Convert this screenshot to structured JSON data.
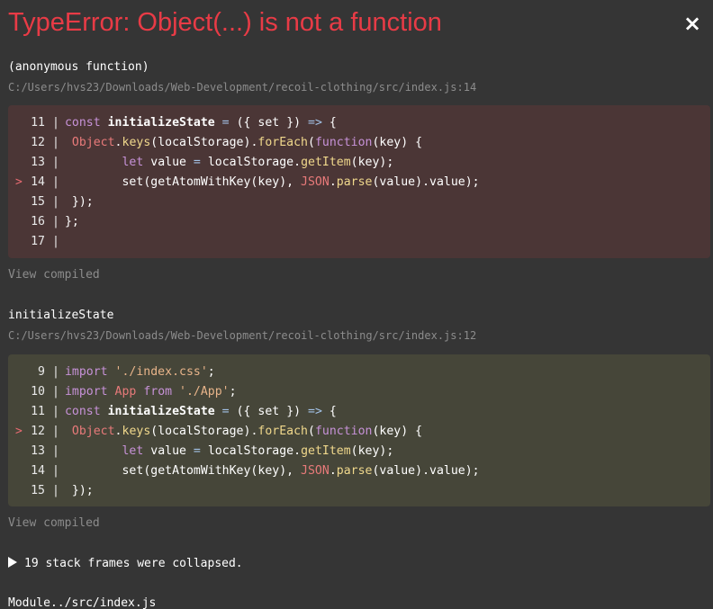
{
  "header": {
    "title": "TypeError: Object(...) is not a function",
    "close_label": "×"
  },
  "frames": [
    {
      "function": "(anonymous function)",
      "path": "C:/Users/hvs23/Downloads/Web-Development/recoil-clothing/src/index.js:14",
      "view_compiled": "View compiled",
      "lines": [
        {
          "num": "11",
          "marker": "",
          "code": "const initializeState = ({ set }) => {"
        },
        {
          "num": "12",
          "marker": "",
          "code": " Object.keys(localStorage).forEach(function(key) {"
        },
        {
          "num": "13",
          "marker": "",
          "code": "        let value = localStorage.getItem(key);"
        },
        {
          "num": "14",
          "marker": ">",
          "code": "        set(getAtomWithKey(key), JSON.parse(value).value);"
        },
        {
          "num": "15",
          "marker": "",
          "code": " });"
        },
        {
          "num": "16",
          "marker": "",
          "code": "};"
        },
        {
          "num": "17",
          "marker": "",
          "code": ""
        }
      ]
    },
    {
      "function": "initializeState",
      "path": "C:/Users/hvs23/Downloads/Web-Development/recoil-clothing/src/index.js:12",
      "view_compiled": "View compiled",
      "lines": [
        {
          "num": "9",
          "marker": "",
          "code": "import './index.css';"
        },
        {
          "num": "10",
          "marker": "",
          "code": "import App from './App';"
        },
        {
          "num": "11",
          "marker": "",
          "code": "const initializeState = ({ set }) => {"
        },
        {
          "num": "12",
          "marker": ">",
          "code": " Object.keys(localStorage).forEach(function(key) {"
        },
        {
          "num": "13",
          "marker": "",
          "code": "        let value = localStorage.getItem(key);"
        },
        {
          "num": "14",
          "marker": "",
          "code": "        set(getAtomWithKey(key), JSON.parse(value).value);"
        },
        {
          "num": "15",
          "marker": "",
          "code": " });"
        }
      ]
    }
  ],
  "collapsed_label": "19 stack frames were collapsed.",
  "next_frame": "Module../src/index.js",
  "colors": {
    "title": "#e83b46",
    "error_box": "#4b3636",
    "context_box": "#464639",
    "background": "#353535"
  }
}
